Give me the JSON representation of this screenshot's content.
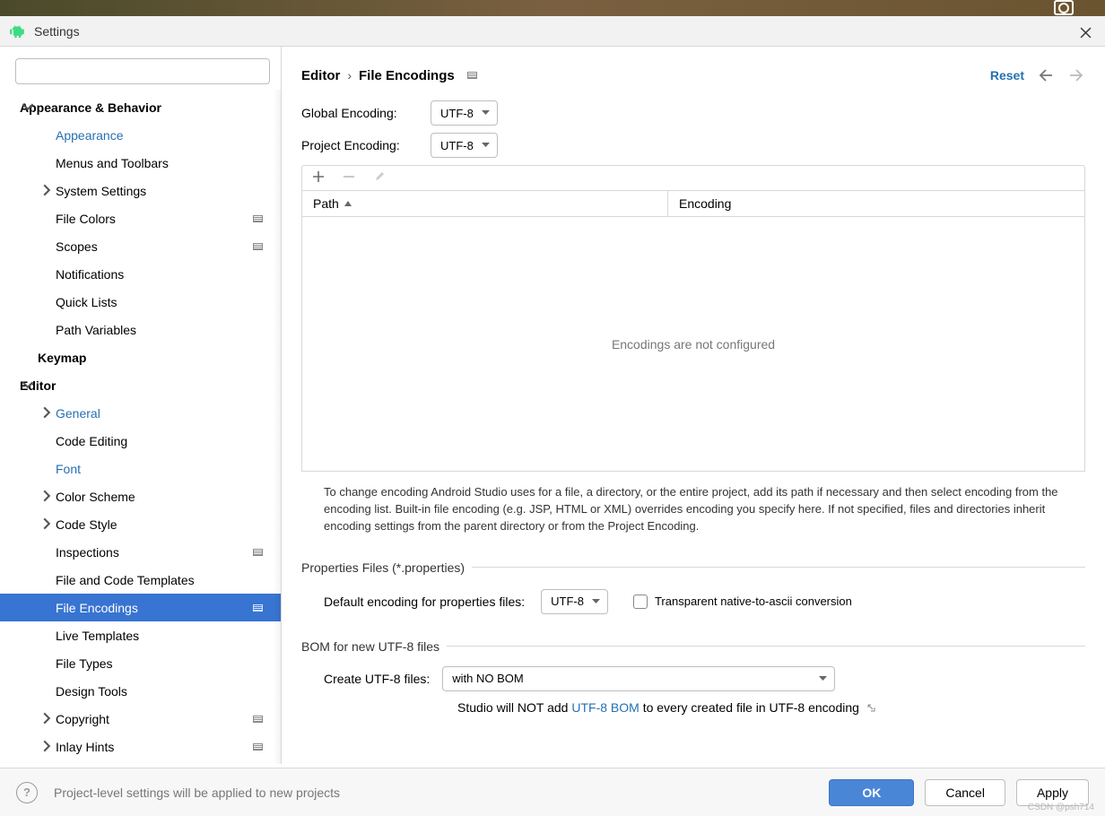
{
  "window": {
    "title": "Settings"
  },
  "breadcrumb": {
    "root": "Editor",
    "leaf": "File Encodings"
  },
  "actions": {
    "reset": "Reset"
  },
  "sidebar": {
    "items": [
      {
        "label": "Appearance & Behavior",
        "type": "cat",
        "expanded": true
      },
      {
        "label": "Appearance",
        "type": "sub1",
        "link": true
      },
      {
        "label": "Menus and Toolbars",
        "type": "sub1"
      },
      {
        "label": "System Settings",
        "type": "sub1",
        "expander": true
      },
      {
        "label": "File Colors",
        "type": "sub1",
        "badge": true
      },
      {
        "label": "Scopes",
        "type": "sub1",
        "badge": true
      },
      {
        "label": "Notifications",
        "type": "sub1"
      },
      {
        "label": "Quick Lists",
        "type": "sub1"
      },
      {
        "label": "Path Variables",
        "type": "sub1"
      },
      {
        "label": "Keymap",
        "type": "cat-plain"
      },
      {
        "label": "Editor",
        "type": "cat",
        "expanded": true
      },
      {
        "label": "General",
        "type": "sub1",
        "link": true,
        "expander": true
      },
      {
        "label": "Code Editing",
        "type": "sub1"
      },
      {
        "label": "Font",
        "type": "sub1",
        "link": true
      },
      {
        "label": "Color Scheme",
        "type": "sub1",
        "expander": true
      },
      {
        "label": "Code Style",
        "type": "sub1",
        "expander": true
      },
      {
        "label": "Inspections",
        "type": "sub1",
        "badge": true
      },
      {
        "label": "File and Code Templates",
        "type": "sub1"
      },
      {
        "label": "File Encodings",
        "type": "sub1",
        "selected": true,
        "badge": true
      },
      {
        "label": "Live Templates",
        "type": "sub1"
      },
      {
        "label": "File Types",
        "type": "sub1"
      },
      {
        "label": "Design Tools",
        "type": "sub1"
      },
      {
        "label": "Copyright",
        "type": "sub1",
        "expander": true,
        "badge": true
      },
      {
        "label": "Inlay Hints",
        "type": "sub1",
        "expander": true,
        "badge": true
      }
    ]
  },
  "encoding": {
    "globalLabel": "Global Encoding:",
    "globalValue": "UTF-8",
    "projectLabel": "Project Encoding:",
    "projectValue": "UTF-8"
  },
  "table": {
    "pathHeader": "Path",
    "encodingHeader": "Encoding",
    "empty": "Encodings are not configured"
  },
  "helpText": "To change encoding Android Studio uses for a file, a directory, or the entire project, add its path if necessary and then select encoding from the encoding list. Built-in file encoding (e.g. JSP, HTML or XML) overrides encoding you specify here. If not specified, files and directories inherit encoding settings from the parent directory or from the Project Encoding.",
  "properties": {
    "legend": "Properties Files (*.properties)",
    "defaultLabel": "Default encoding for properties files:",
    "defaultValue": "UTF-8",
    "transparent": "Transparent native-to-ascii conversion"
  },
  "bom": {
    "legend": "BOM for new UTF-8 files",
    "createLabel": "Create UTF-8 files:",
    "createValue": "with NO BOM",
    "notePrefix": "Studio will NOT add ",
    "noteLink": "UTF-8 BOM",
    "noteSuffix": " to every created file in UTF-8 encoding"
  },
  "footer": {
    "note": "Project-level settings will be applied to new projects",
    "ok": "OK",
    "cancel": "Cancel",
    "apply": "Apply"
  },
  "watermark": "CSDN @psh714"
}
